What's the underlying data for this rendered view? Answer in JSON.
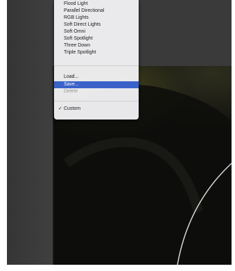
{
  "menu": {
    "items": [
      {
        "label": "Flood Light"
      },
      {
        "label": "Parallel Directional"
      },
      {
        "label": "RGB Lights"
      },
      {
        "label": "Soft Direct Lights"
      },
      {
        "label": "Soft Omni"
      },
      {
        "label": "Soft Spotlight"
      },
      {
        "label": "Three Down"
      },
      {
        "label": "Triple Spotlight"
      }
    ],
    "actions": [
      {
        "label": "Load..."
      },
      {
        "label": "Save..."
      },
      {
        "label": "Delete"
      }
    ],
    "custom": {
      "label": "Custom",
      "check": "✓"
    },
    "highlight_color": "#3a62c9"
  }
}
